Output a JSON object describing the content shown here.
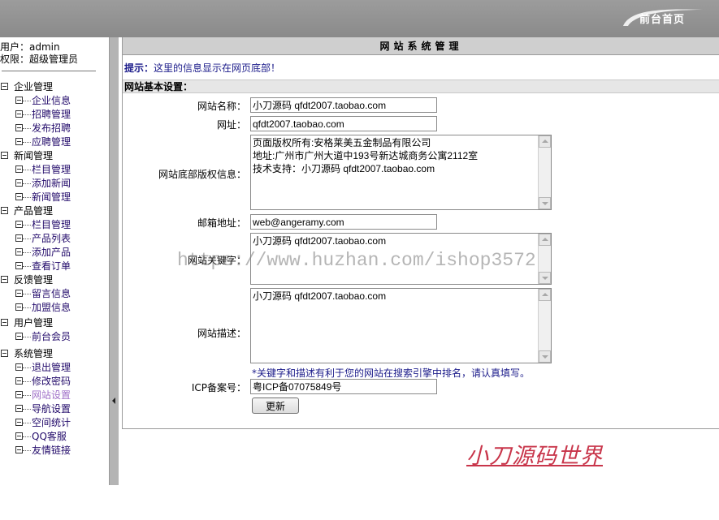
{
  "header": {
    "home_label": "前台首页"
  },
  "user": {
    "name_line": "用户：admin",
    "role_line": "权限：超级管理员"
  },
  "tree": [
    {
      "label": "企业管理",
      "items": [
        "企业信息",
        "招聘管理",
        "发布招聘",
        "应聘管理"
      ]
    },
    {
      "label": "新闻管理",
      "items": [
        "栏目管理",
        "添加新闻",
        "新闻管理"
      ]
    },
    {
      "label": "产品管理",
      "items": [
        "栏目管理",
        "产品列表",
        "添加产品",
        "查看订单"
      ]
    },
    {
      "label": "反馈管理",
      "items": [
        "留言信息",
        "加盟信息"
      ]
    },
    {
      "label": "用户管理",
      "items": [
        "前台会员"
      ]
    },
    {
      "label": "系统管理",
      "items": [
        "退出管理",
        "修改密码",
        "网站设置",
        "导航设置",
        "空间统计",
        "QQ客服",
        "友情链接"
      ]
    }
  ],
  "active_item": "网站设置",
  "panel": {
    "title": "网站系统管理",
    "tip_prefix": "提示：",
    "tip_text": "这里的信息显示在网页底部！",
    "section": "网站基本设置："
  },
  "form": {
    "site_name_label": "网站名称：",
    "site_name": "小刀源码 qfdt2007.taobao.com",
    "url_label": "网址：",
    "url": "qfdt2007.taobao.com",
    "copyright_label": "网站底部版权信息：",
    "copyright": "页面版权所有:安格莱美五金制品有限公司\n地址:广州市广州大道中193号新达城商务公寓2112室\n技术支持：小刀源码 qfdt2007.taobao.com",
    "email_label": "邮箱地址：",
    "email": "web@angeramy.com",
    "keywords_label": "网站关键字：",
    "keywords": "小刀源码 qfdt2007.taobao.com",
    "description_label": "网站描述：",
    "description": "小刀源码 qfdt2007.taobao.com",
    "hint": "*关键字和描述有利于您的网站在搜索引擎中排名，请认真填写。",
    "icp_label": "ICP备案号：",
    "icp": "粤ICP备07075849号",
    "submit_label": "更新"
  },
  "overlay": {
    "signature": "小刀源码世界",
    "watermark": "https://www.huzhan.com/ishop3572"
  }
}
